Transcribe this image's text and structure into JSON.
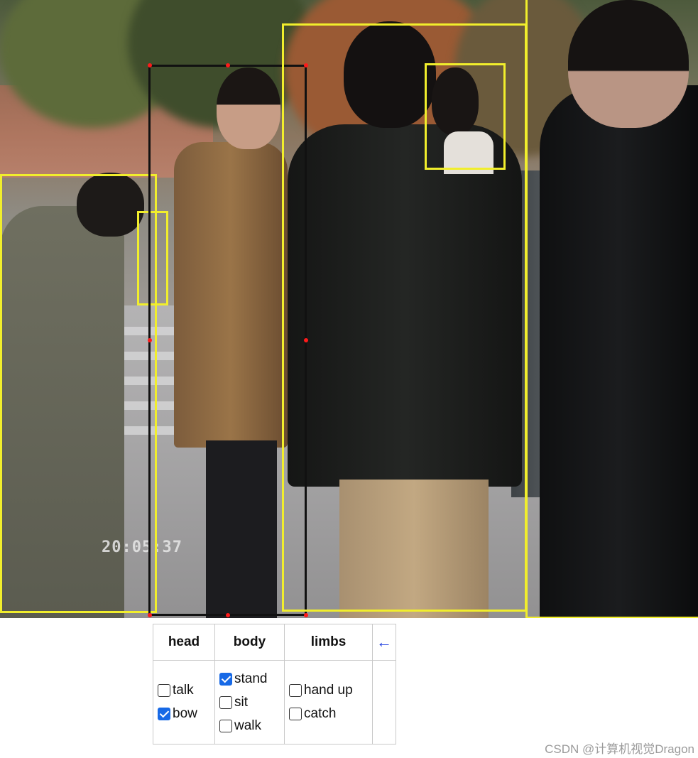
{
  "video": {
    "timestamp": "20:05:37"
  },
  "annotation_panel": {
    "headers": {
      "head": "head",
      "body": "body",
      "limbs": "limbs",
      "back_arrow": "←"
    },
    "head_options": [
      {
        "label": "talk",
        "checked": false
      },
      {
        "label": "bow",
        "checked": true
      }
    ],
    "body_options": [
      {
        "label": "stand",
        "checked": true
      },
      {
        "label": "sit",
        "checked": false
      },
      {
        "label": "walk",
        "checked": false
      }
    ],
    "limbs_options": [
      {
        "label": "hand up",
        "checked": false
      },
      {
        "label": "catch",
        "checked": false
      }
    ]
  },
  "colors": {
    "bbox_default": "#f1ee2c",
    "bbox_selected": "#111111",
    "handle": "#ff1a1a",
    "checkbox_checked": "#1769e6",
    "arrow": "#1f3fe0"
  },
  "watermark": "CSDN @计算机视觉Dragon"
}
